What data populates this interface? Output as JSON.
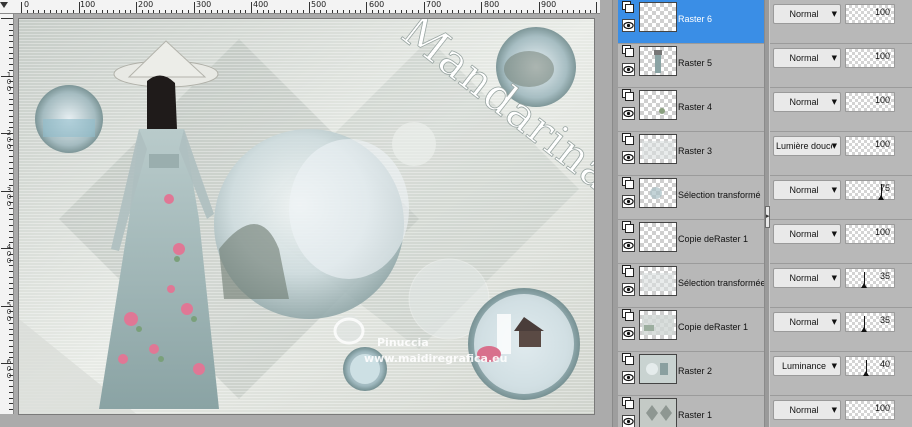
{
  "canvas": {
    "ruler_top_labels": [
      "0",
      "100",
      "200",
      "300",
      "400",
      "500",
      "600",
      "700",
      "800",
      "900"
    ],
    "ruler_left_labels": [
      "100",
      "200",
      "300",
      "400",
      "500",
      "600"
    ],
    "artwork": {
      "title_text": "Mandarina",
      "watermark_name": "Pinuccia",
      "watermark_url": "www.maidiregrafica.eu"
    }
  },
  "layers": [
    {
      "name": "Raster 6",
      "blend": "Normal",
      "opacity": "100",
      "opacity_level": 100,
      "selected": true,
      "thumb": "empty"
    },
    {
      "name": "Raster 5",
      "blend": "Normal",
      "opacity": "100",
      "opacity_level": 100,
      "selected": false,
      "thumb": "woman"
    },
    {
      "name": "Raster 4",
      "blend": "Normal",
      "opacity": "100",
      "opacity_level": 100,
      "selected": false,
      "thumb": "small"
    },
    {
      "name": "Raster 3",
      "blend": "Lumière douce",
      "opacity": "100",
      "opacity_level": 100,
      "selected": false,
      "thumb": "faint"
    },
    {
      "name": "Sélection transformé",
      "blend": "Normal",
      "opacity": "75",
      "opacity_level": 75,
      "selected": false,
      "thumb": "bubble"
    },
    {
      "name": "Copie deRaster 1",
      "blend": "Normal",
      "opacity": "100",
      "opacity_level": 100,
      "selected": false,
      "thumb": "empty"
    },
    {
      "name": "Sélection transformée",
      "blend": "Normal",
      "opacity": "35",
      "opacity_level": 35,
      "selected": false,
      "thumb": "faint"
    },
    {
      "name": "Copie deRaster 1",
      "blend": "Normal",
      "opacity": "35",
      "opacity_level": 35,
      "selected": false,
      "thumb": "faint2"
    },
    {
      "name": "Raster 2",
      "blend": "Luminance",
      "opacity": "40",
      "opacity_level": 40,
      "selected": false,
      "thumb": "landscape"
    },
    {
      "name": "Raster 1",
      "blend": "Normal",
      "opacity": "100",
      "opacity_level": 100,
      "selected": false,
      "thumb": "pattern"
    }
  ],
  "colors": {
    "selection": "#3a8ee6",
    "panel": "#b8b8b8",
    "canvas_bg": "#e3e6e2"
  }
}
